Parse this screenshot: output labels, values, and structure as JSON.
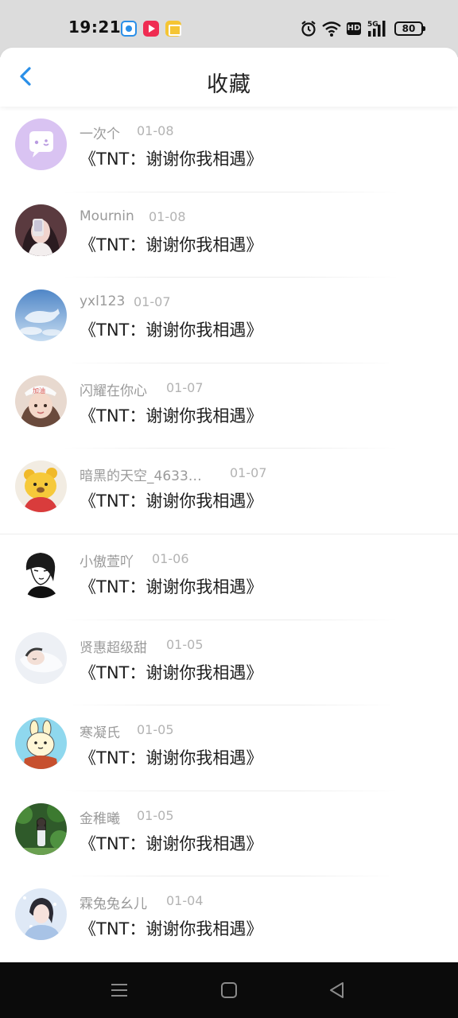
{
  "status_bar": {
    "time": "19:21",
    "hd_label": "HD",
    "network": "5G",
    "battery": "80"
  },
  "header": {
    "title": "收藏"
  },
  "items": [
    {
      "name": "一次个",
      "date": "01-08",
      "title": "《TNT：谢谢你我相遇》",
      "avatar": "chat-bubble-avatar"
    },
    {
      "name": "Mournin",
      "date": "01-08",
      "title": "《TNT：谢谢你我相遇》",
      "avatar": "girl-selfie-avatar"
    },
    {
      "name": "yxl123",
      "date": "01-07",
      "title": "《TNT：谢谢你我相遇》",
      "avatar": "whale-sky-avatar"
    },
    {
      "name": "闪耀在你心",
      "date": "01-07",
      "title": "《TNT：谢谢你我相遇》",
      "avatar": "girl-cap-avatar"
    },
    {
      "name": "暗黑的天空_4633…",
      "date": "01-07",
      "title": "《TNT：谢谢你我相遇》",
      "avatar": "bear-plush-avatar"
    },
    {
      "name": "小傲萱吖",
      "date": "01-06",
      "title": "《TNT：谢谢你我相遇》",
      "avatar": "sketch-portrait-avatar"
    },
    {
      "name": "贤惠超级甜",
      "date": "01-05",
      "title": "《TNT：谢谢你我相遇》",
      "avatar": "sleeping-avatar"
    },
    {
      "name": "寒凝氏",
      "date": "01-05",
      "title": "《TNT：谢谢你我相遇》",
      "avatar": "cartoon-bunny-avatar"
    },
    {
      "name": "金稚曦",
      "date": "01-05",
      "title": "《TNT：谢谢你我相遇》",
      "avatar": "forest-girl-avatar"
    },
    {
      "name": "霖兔兔幺儿",
      "date": "01-04",
      "title": "《TNT：谢谢你我相遇》",
      "avatar": "snow-girl-avatar"
    }
  ],
  "colors": {
    "accent": "#2a8fe8",
    "status_bar_bg": "#dcdcdc",
    "nav_bar_bg": "#0b0b0b"
  }
}
